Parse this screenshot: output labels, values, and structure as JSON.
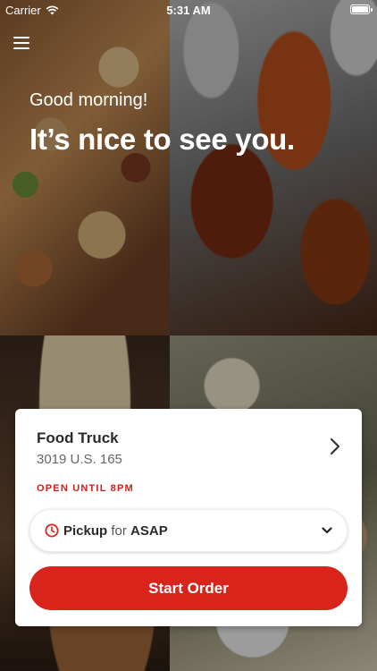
{
  "status_bar": {
    "carrier": "Carrier",
    "time": "5:31 AM",
    "battery_level": 1.0
  },
  "header": {
    "greeting": "Good morning!",
    "headline": "It’s nice to see you."
  },
  "location_card": {
    "store_name": "Food Truck",
    "address": "3019 U.S. 165",
    "open_status": "OPEN UNTIL 8PM",
    "order_type": "Pickup",
    "order_connector": "for",
    "order_time": "ASAP",
    "start_button": "Start Order"
  },
  "colors": {
    "accent": "#d8241b",
    "status_red": "#d0201c"
  },
  "icons": {
    "menu": "hamburger-menu-icon",
    "wifi": "wifi-icon",
    "battery": "battery-icon",
    "store_arrow": "chevron-right-icon",
    "clock": "clock-icon",
    "dropdown": "chevron-down-icon"
  }
}
